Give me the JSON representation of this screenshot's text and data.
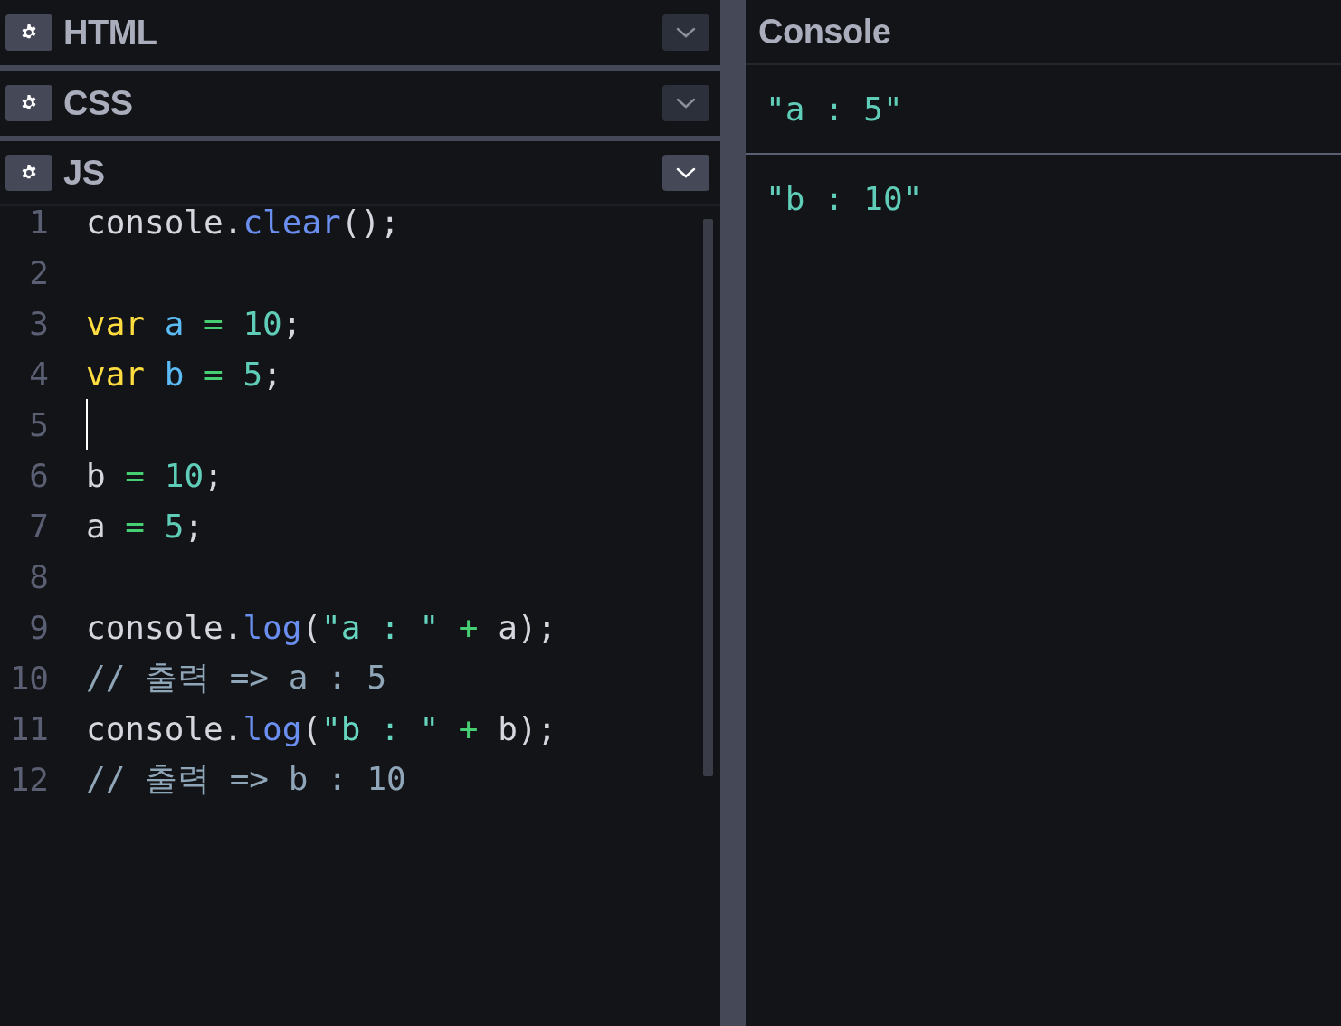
{
  "editors": [
    {
      "title": "HTML",
      "expanded": false
    },
    {
      "title": "CSS",
      "expanded": false
    },
    {
      "title": "JS",
      "expanded": true
    }
  ],
  "code": {
    "lines": [
      {
        "number": "1",
        "cursor": false,
        "tokens": [
          {
            "kind": "plain",
            "text": "console."
          },
          {
            "kind": "method",
            "text": "clear"
          },
          {
            "kind": "plain",
            "text": "();"
          }
        ]
      },
      {
        "number": "2",
        "cursor": false
      },
      {
        "number": "3",
        "cursor": false,
        "tokens": [
          {
            "kind": "keyword",
            "text": "var"
          },
          {
            "kind": "variable",
            "text": " a"
          },
          {
            "kind": "operator",
            "text": " ="
          },
          {
            "kind": "number",
            "text": " 10"
          },
          {
            "kind": "plain",
            "text": ";"
          }
        ]
      },
      {
        "number": "4",
        "cursor": false,
        "tokens": [
          {
            "kind": "keyword",
            "text": "var"
          },
          {
            "kind": "variable",
            "text": " b"
          },
          {
            "kind": "operator",
            "text": " ="
          },
          {
            "kind": "number",
            "text": " 5"
          },
          {
            "kind": "plain",
            "text": ";"
          }
        ]
      },
      {
        "number": "5",
        "cursor": true
      },
      {
        "number": "6",
        "cursor": false,
        "tokens": [
          {
            "kind": "plain",
            "text": "b"
          },
          {
            "kind": "operator",
            "text": " ="
          },
          {
            "kind": "number",
            "text": " 10"
          },
          {
            "kind": "plain",
            "text": ";"
          }
        ]
      },
      {
        "number": "7",
        "cursor": false,
        "tokens": [
          {
            "kind": "plain",
            "text": "a"
          },
          {
            "kind": "operator",
            "text": " ="
          },
          {
            "kind": "number",
            "text": " 5"
          },
          {
            "kind": "plain",
            "text": ";"
          }
        ]
      },
      {
        "number": "8",
        "cursor": false
      },
      {
        "number": "9",
        "cursor": false,
        "tokens": [
          {
            "kind": "plain",
            "text": "console."
          },
          {
            "kind": "method",
            "text": "log"
          },
          {
            "kind": "plain",
            "text": "("
          },
          {
            "kind": "string",
            "text": "\"a : \""
          },
          {
            "kind": "operator",
            "text": " +"
          },
          {
            "kind": "plain",
            "text": " a);"
          }
        ]
      },
      {
        "number": "10",
        "cursor": false,
        "tokens": [
          {
            "kind": "comment",
            "text": "// 출력 => a : 5"
          }
        ]
      },
      {
        "number": "11",
        "cursor": false,
        "tokens": [
          {
            "kind": "plain",
            "text": "console."
          },
          {
            "kind": "method",
            "text": "log"
          },
          {
            "kind": "plain",
            "text": "("
          },
          {
            "kind": "string",
            "text": "\"b : \""
          },
          {
            "kind": "operator",
            "text": " +"
          },
          {
            "kind": "plain",
            "text": " b);"
          }
        ]
      },
      {
        "number": "12",
        "cursor": false,
        "tokens": [
          {
            "kind": "comment",
            "text": "// 출력 => b : 10"
          }
        ]
      }
    ]
  },
  "console": {
    "title": "Console",
    "entries": [
      "\"a : 5\"",
      "\"b : 10\""
    ]
  }
}
